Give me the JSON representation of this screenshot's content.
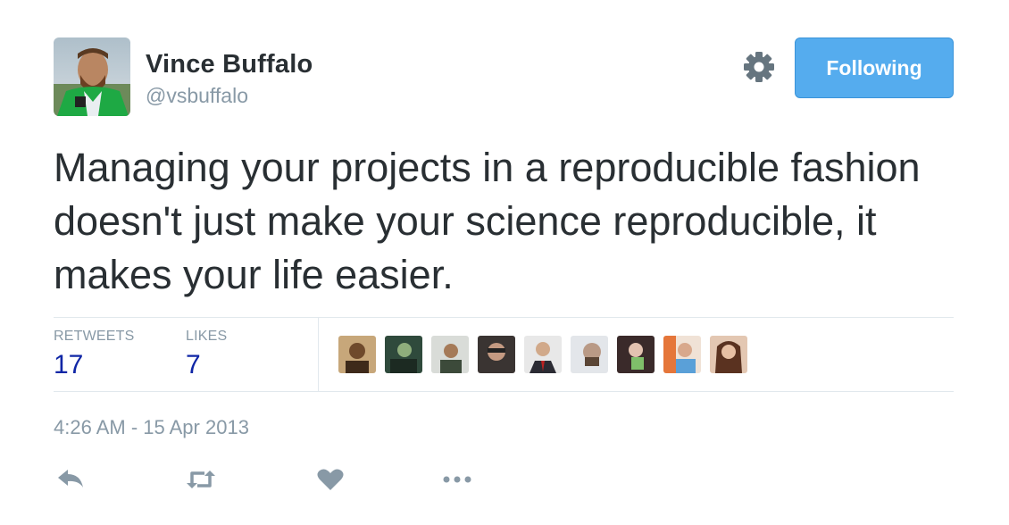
{
  "author": {
    "name": "Vince Buffalo",
    "handle": "@vsbuffalo",
    "avatar_icon": "profile-photo"
  },
  "header": {
    "settings_icon": "gear-icon",
    "follow_label": "Following",
    "follow_color": "#55acee"
  },
  "tweet": {
    "text": "Managing your projects in a reproducible fashion doesn't just make your science reproducible, it makes your life easier.",
    "timestamp": "4:26 AM - 15 Apr 2013"
  },
  "stats": {
    "retweets_label": "RETWEETS",
    "retweets_count": "17",
    "likes_label": "LIKES",
    "likes_count": "7",
    "count_color": "#0f26a6"
  },
  "likers": [
    {
      "icon": "user-avatar"
    },
    {
      "icon": "user-avatar"
    },
    {
      "icon": "user-avatar"
    },
    {
      "icon": "user-avatar"
    },
    {
      "icon": "user-avatar"
    },
    {
      "icon": "user-avatar"
    },
    {
      "icon": "user-avatar"
    },
    {
      "icon": "user-avatar"
    },
    {
      "icon": "user-avatar"
    }
  ],
  "actions": [
    {
      "icon": "reply-icon"
    },
    {
      "icon": "retweet-icon"
    },
    {
      "icon": "like-icon"
    },
    {
      "icon": "more-icon"
    }
  ]
}
